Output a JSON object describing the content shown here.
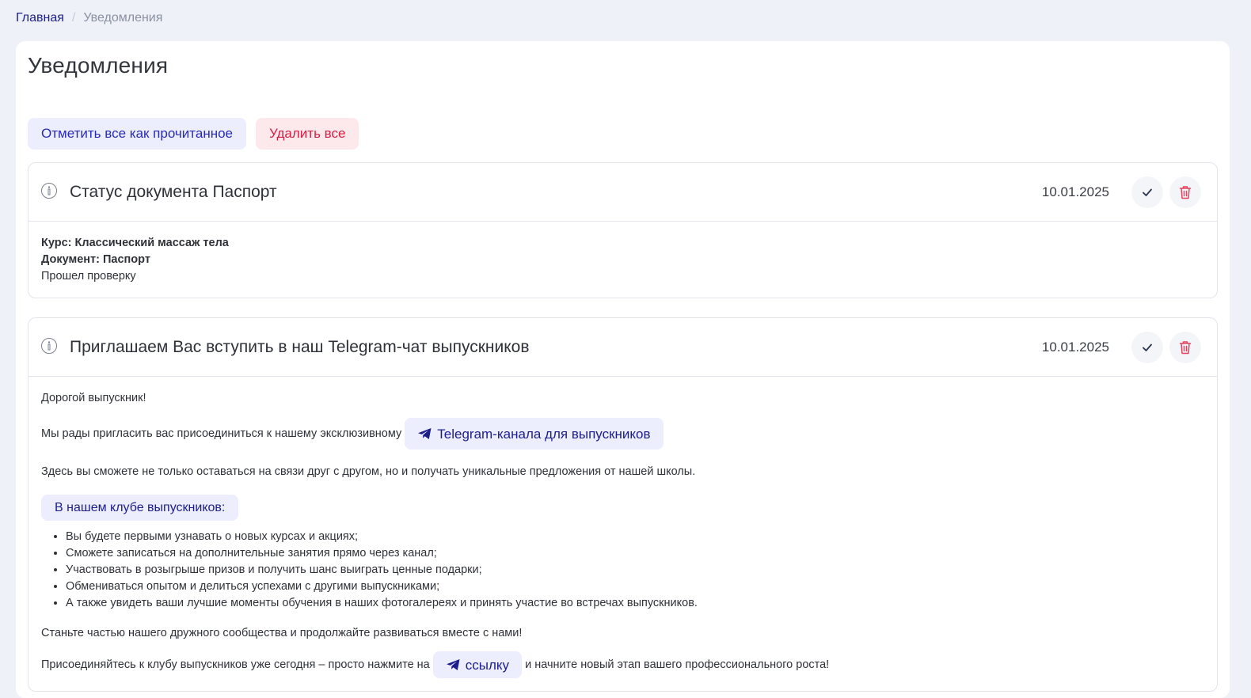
{
  "breadcrumb": {
    "home": "Главная",
    "separator": "/",
    "current": "Уведомления"
  },
  "page": {
    "title": "Уведомления",
    "mark_all_read": "Отметить все как прочитанное",
    "delete_all": "Удалить все"
  },
  "notifications": [
    {
      "title": "Статус документа Паспорт",
      "date": "10.01.2025",
      "course_line": "Курс: Классический массаж тела",
      "document_line": "Документ: Паспорт",
      "status_line": "Прошел проверку"
    },
    {
      "title": "Приглашаем Вас вступить в наш Telegram-чат выпускников",
      "date": "10.01.2025",
      "greeting": "Дорогой выпускник!",
      "invite_text": "Мы рады пригласить вас присоединиться к нашему эксклюзивному",
      "channel_link": "Telegram-канала для выпускников",
      "benefit_intro": "Здесь вы сможете не только оставаться на связи друг с другом, но и получать уникальные предложения от нашей школы.",
      "club_label": "В нашем клубе выпускников:",
      "benefits": [
        "Вы будете первыми узнавать о новых курсах и акциях;",
        "Сможете записаться на дополнительные занятия прямо через канал;",
        "Участвовать в розыгрыше призов и получить шанс выиграть ценные подарки;",
        "Обмениваться опытом и делиться успехами с другими выпускниками;",
        "А также увидеть ваши лучшие моменты обучения в наших фотогалереях и принять участие во встречах выпускников."
      ],
      "community_text": "Станьте частью нашего дружного сообщества и продолжайте развиваться вместе с нами!",
      "join_before": "Присоединяйтесь к клубу выпускников уже сегодня – просто нажмите на",
      "join_link": "ссылку",
      "join_after": "и начните новый этап вашего профессионального роста!"
    }
  ],
  "colors": {
    "accent": "#1d1d8c",
    "danger": "#d42045",
    "pill_bg": "#eceefd",
    "page_bg": "#eef1f8"
  },
  "icons": [
    "info-icon",
    "check-icon",
    "trash-icon",
    "telegram-icon"
  ]
}
